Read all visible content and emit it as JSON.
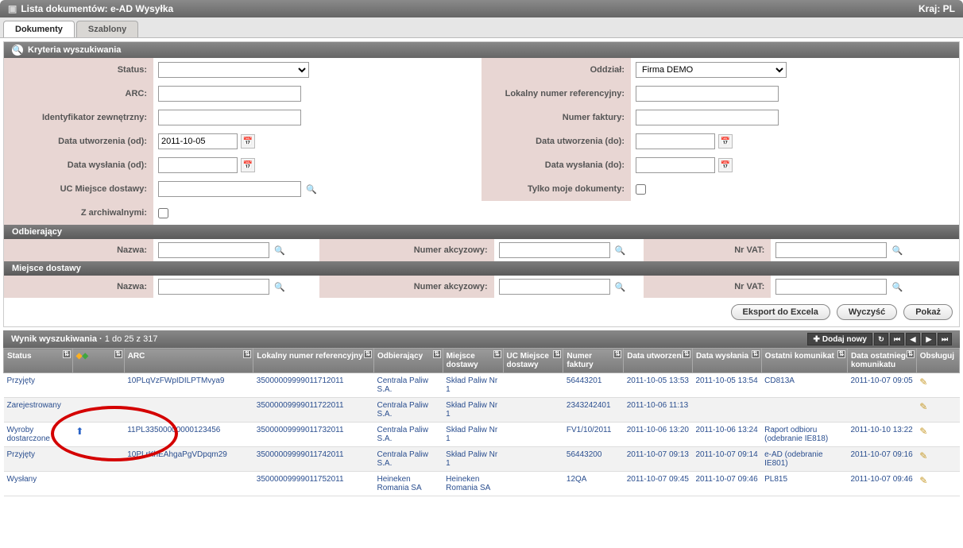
{
  "header": {
    "title": "Lista dokumentów:  e-AD Wysyłka",
    "country_label": "Kraj: PL"
  },
  "tabs": {
    "documents": "Dokumenty",
    "templates": "Szablony"
  },
  "criteria": {
    "title": "Kryteria wyszukiwania",
    "labels": {
      "status": "Status:",
      "arc": "ARC:",
      "ext_id": "Identyfikator zewnętrzny:",
      "created_from": "Data utworzenia (od):",
      "sent_from": "Data wysłania (od):",
      "uc_delivery": "UC Miejsce dostawy:",
      "with_archive": "Z archiwalnymi:",
      "branch": "Oddział:",
      "local_ref": "Lokalny numer referencyjny:",
      "invoice": "Numer faktury:",
      "created_to": "Data utworzenia (do):",
      "sent_to": "Data wysłania (do):",
      "only_mine": "Tylko moje dokumenty:"
    },
    "values": {
      "created_from": "2011-10-05",
      "branch": "Firma DEMO"
    }
  },
  "receiver_section": {
    "title": "Odbierający",
    "name": "Nazwa:",
    "excise": "Numer akcyzowy:",
    "vat": "Nr VAT:"
  },
  "delivery_section": {
    "title": "Miejsce dostawy",
    "name": "Nazwa:",
    "excise": "Numer akcyzowy:",
    "vat": "Nr VAT:"
  },
  "buttons": {
    "export": "Eksport do Excela",
    "clear": "Wyczyść",
    "show": "Pokaż",
    "addnew": "Dodaj nowy"
  },
  "results": {
    "title": "Wynik wyszukiwania ·",
    "range": "1 do 25 z 317",
    "columns": {
      "status": "Status",
      "icons": "",
      "arc": "ARC",
      "local_ref": "Lokalny numer referencyjny",
      "receiver": "Odbierający",
      "delivery": "Miejsce dostawy",
      "uc": "UC Miejsce dostawy",
      "invoice": "Numer faktury",
      "created": "Data utworzenia",
      "sent": "Data wysłania",
      "last_msg": "Ostatni komunikat",
      "last_msg_date": "Data ostatniego komunikatu",
      "manage": "Obsługuj"
    },
    "rows": [
      {
        "status": "Przyjęty",
        "icon": "",
        "arc": "10PLqVzFWpIDILPTMvya9",
        "local": "3500000999901171201​1",
        "recv": "Centrala Paliw S.A.",
        "deliv": "Skład Paliw Nr 1",
        "uc": "",
        "inv": "56443201",
        "created": "2011-10-05 13:53",
        "sent": "2011-10-05 13:54",
        "msg": "CD813A",
        "msgdate": "2011-10-07 09:05"
      },
      {
        "status": "Zarejestrowany",
        "icon": "",
        "arc": "",
        "local": "35000009999011722011",
        "recv": "Centrala Paliw S.A.",
        "deliv": "Skład Paliw Nr 1",
        "uc": "",
        "inv": "2343242401",
        "created": "2011-10-06 11:13",
        "sent": "",
        "msg": "",
        "msgdate": ""
      },
      {
        "status": "Wyroby dostarczone",
        "icon": "⬆",
        "arc": "11PL33500000000123456",
        "local": "35000009999011732011",
        "recv": "Centrala Paliw S.A.",
        "deliv": "Skład Paliw Nr 1",
        "uc": "",
        "inv": "FV1/10/2011",
        "created": "2011-10-06 13:20",
        "sent": "2011-10-06 13:24",
        "msg": "Raport odbioru (odebranie IE818)",
        "msgdate": "2011-10-10 13:22"
      },
      {
        "status": "Przyjęty",
        "icon": "",
        "arc": "10PLrKhEAhgaPgVDpqm29",
        "local": "35000009999011742011",
        "recv": "Centrala Paliw S.A.",
        "deliv": "Skład Paliw Nr 1",
        "uc": "",
        "inv": "56443200",
        "created": "2011-10-07 09:13",
        "sent": "2011-10-07 09:14",
        "msg": "e-AD (odebranie IE801)",
        "msgdate": "2011-10-07 09:16"
      },
      {
        "status": "Wysłany",
        "icon": "",
        "arc": "",
        "local": "35000009999011752011",
        "recv": "Heineken Romania SA",
        "deliv": "Heineken Romania SA",
        "uc": "",
        "inv": "12QA",
        "created": "2011-10-07 09:45",
        "sent": "2011-10-07 09:46",
        "msg": "PL815",
        "msgdate": "2011-10-07 09:46"
      }
    ]
  }
}
